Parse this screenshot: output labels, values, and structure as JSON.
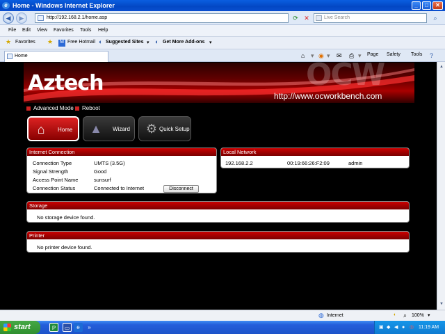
{
  "window": {
    "title": "Home - Windows Internet Explorer"
  },
  "browser": {
    "address": "http://192.168.2.1/home.asp",
    "search_placeholder": "Live Search",
    "menu": [
      "File",
      "Edit",
      "View",
      "Favorites",
      "Tools",
      "Help"
    ],
    "favorites_label": "Favorites",
    "fav_links": [
      "Free Hotmail",
      "Suggested Sites",
      "Get More Add-ons"
    ],
    "tab_label": "Home",
    "toolbar": {
      "page": "Page",
      "safety": "Safety",
      "tools": "Tools"
    }
  },
  "router": {
    "brand": "Aztech",
    "watermark": "OCW",
    "watermark_url": "http://www.ocworkbench.com",
    "links": {
      "advanced": "Advanced Mode",
      "reboot": "Reboot"
    },
    "nav": {
      "home": "Home",
      "wizard": "Wizard",
      "quick_setup": "Quick Setup"
    },
    "internet": {
      "title": "Internet Connection",
      "rows": [
        {
          "label": "Connection Type",
          "value": "UMTS (3.5G)"
        },
        {
          "label": "Signal Strength",
          "value": "Good"
        },
        {
          "label": "Access Point Name",
          "value": "sunsurf"
        },
        {
          "label": "Connection Status",
          "value": "Connected to Internet"
        }
      ],
      "disconnect": "Disconnect"
    },
    "local": {
      "title": "Local Network",
      "ip": "192.168.2.2",
      "mac": "00:19:66:26:F2:09",
      "name": "admin"
    },
    "storage": {
      "title": "Storage",
      "message": "No storage device found."
    },
    "printer": {
      "title": "Printer",
      "message": "No printer device found."
    }
  },
  "statusbar": {
    "zone": "Internet",
    "zoom": "100%"
  },
  "taskbar": {
    "start": "start",
    "time": "11:19 AM"
  },
  "colors": {
    "accent": "#cc0000",
    "background": "#000000"
  }
}
